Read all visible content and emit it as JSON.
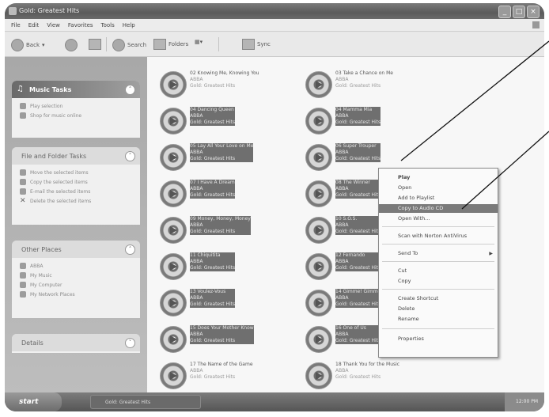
{
  "window": {
    "title": "Gold: Greatest Hits"
  },
  "menu": [
    "File",
    "Edit",
    "View",
    "Favorites",
    "Tools",
    "Help"
  ],
  "toolbar": {
    "back": "Back",
    "search": "Search",
    "folders": "Folders",
    "views": "▦▾",
    "sync": "Sync"
  },
  "left": {
    "music_tasks": {
      "title": "Music Tasks",
      "items": [
        "Play selection",
        "Shop for music online"
      ]
    },
    "file_tasks": {
      "title": "File and Folder Tasks",
      "items": [
        "Move the selected items",
        "Copy the selected items",
        "E-mail the selected items",
        "Delete the selected items"
      ]
    },
    "other_places": {
      "title": "Other Places",
      "items": [
        "ABBA",
        "My Music",
        "My Computer",
        "My Network Places"
      ]
    },
    "details": {
      "title": "Details"
    }
  },
  "tracks": [
    {
      "title": "02 Knowing Me, Knowing You",
      "artist": "ABBA",
      "album": "Gold: Greatest Hits",
      "selected": false
    },
    {
      "title": "03 Take a Chance on Me",
      "artist": "ABBA",
      "album": "Gold: Greatest Hits",
      "selected": false
    },
    {
      "title": "04 Dancing Queen",
      "artist": "ABBA",
      "album": "Gold: Greatest Hits",
      "selected": true
    },
    {
      "title": "04 Mamma Mia",
      "artist": "ABBA",
      "album": "Gold: Greatest Hits",
      "selected": true
    },
    {
      "title": "05 Lay All Your Love on Me",
      "artist": "ABBA",
      "album": "Gold: Greatest Hits",
      "selected": true
    },
    {
      "title": "06 Super Trouper",
      "artist": "ABBA",
      "album": "Gold: Greatest Hits",
      "selected": true
    },
    {
      "title": "07 I Have A Dream",
      "artist": "ABBA",
      "album": "Gold: Greatest Hits",
      "selected": true
    },
    {
      "title": "08 The Winner",
      "artist": "ABBA",
      "album": "Gold: Greatest Hits",
      "selected": true
    },
    {
      "title": "09 Money, Money, Money",
      "artist": "ABBA",
      "album": "Gold: Greatest Hits",
      "selected": true
    },
    {
      "title": "10 S.O.S.",
      "artist": "ABBA",
      "album": "Gold: Greatest Hits",
      "selected": true
    },
    {
      "title": "11 Chiquitita",
      "artist": "ABBA",
      "album": "Gold: Greatest Hits",
      "selected": true
    },
    {
      "title": "12 Fernando",
      "artist": "ABBA",
      "album": "Gold: Greatest Hits",
      "selected": true
    },
    {
      "title": "13 Voulez-Vous",
      "artist": "ABBA",
      "album": "Gold: Greatest Hits",
      "selected": true
    },
    {
      "title": "14 Gimme! Gimme!",
      "artist": "ABBA",
      "album": "Gold: Greatest Hits",
      "selected": true
    },
    {
      "title": "15 Does Your Mother Know",
      "artist": "ABBA",
      "album": "Gold: Greatest Hits",
      "selected": true
    },
    {
      "title": "16 One of Us",
      "artist": "ABBA",
      "album": "Gold: Greatest Hits",
      "selected": true
    },
    {
      "title": "17 The Name of the Game",
      "artist": "ABBA",
      "album": "Gold: Greatest Hits",
      "selected": false
    },
    {
      "title": "18 Thank You for the Music",
      "artist": "ABBA",
      "album": "Gold: Greatest Hits",
      "selected": false
    }
  ],
  "context_menu": {
    "items": [
      "Play",
      "Open",
      "Add to Playlist",
      "Copy to Audio CD",
      "Open With...",
      "Scan with Norton AntiVirus",
      "Send To",
      "Cut",
      "Copy",
      "Create Shortcut",
      "Delete",
      "Rename",
      "Properties"
    ]
  },
  "taskbar": {
    "start": "start",
    "task": "Gold: Greatest Hits",
    "clock": "12:00 PM"
  }
}
